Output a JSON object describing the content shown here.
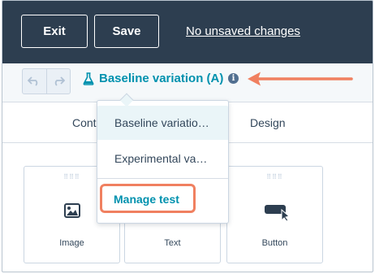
{
  "topbar": {
    "exit_label": "Exit",
    "save_label": "Save",
    "status_link": "No unsaved changes"
  },
  "toolbar": {
    "variation_label": "Baseline variation (A)",
    "info_glyph": "i"
  },
  "tabs": [
    {
      "label": "Cont"
    },
    {
      "label": "Design"
    }
  ],
  "dropdown": {
    "items": [
      {
        "label": "Baseline variatio…"
      },
      {
        "label": "Experimental va…"
      }
    ],
    "manage_label": "Manage test"
  },
  "modules": [
    {
      "label": "Image",
      "icon": "image-icon"
    },
    {
      "label": "Text",
      "icon": "text-icon"
    },
    {
      "label": "Button",
      "icon": "button-icon"
    }
  ],
  "colors": {
    "topbar_bg": "#2d3e50",
    "link_teal": "#0091ae",
    "highlight_orange": "#f08060"
  }
}
